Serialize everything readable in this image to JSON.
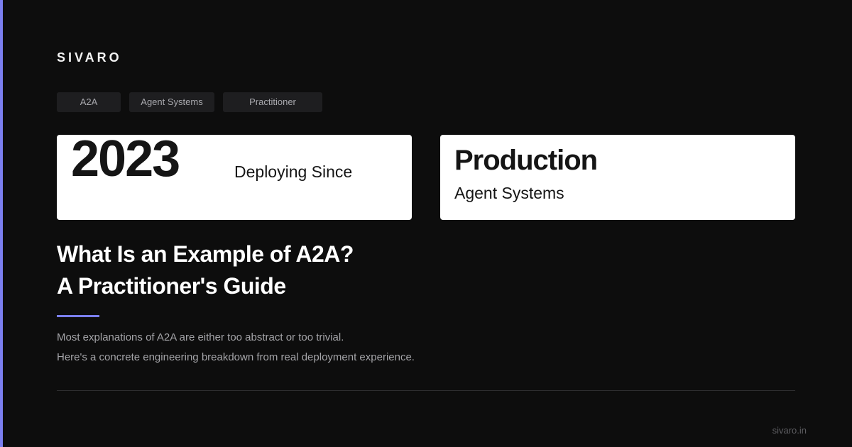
{
  "brand": "SIVARO",
  "tags": [
    "A2A",
    "Agent Systems",
    "Practitioner"
  ],
  "stat_cards": [
    {
      "value": "2023",
      "caption": "Deploying Since"
    },
    {
      "heading": "Production",
      "caption": "Agent Systems"
    }
  ],
  "headline": {
    "line1": "What Is an Example of A2A?",
    "line2": "A Practitioner's Guide"
  },
  "description": {
    "line1": "Most explanations of A2A are either too abstract or too trivial.",
    "line2": "Here's a concrete engineering breakdown from real deployment experience."
  },
  "footer": {
    "domain": "sivaro.in"
  },
  "colors": {
    "accent": "#7b7ff0",
    "background": "#0d0d0d",
    "card": "#ffffff"
  }
}
